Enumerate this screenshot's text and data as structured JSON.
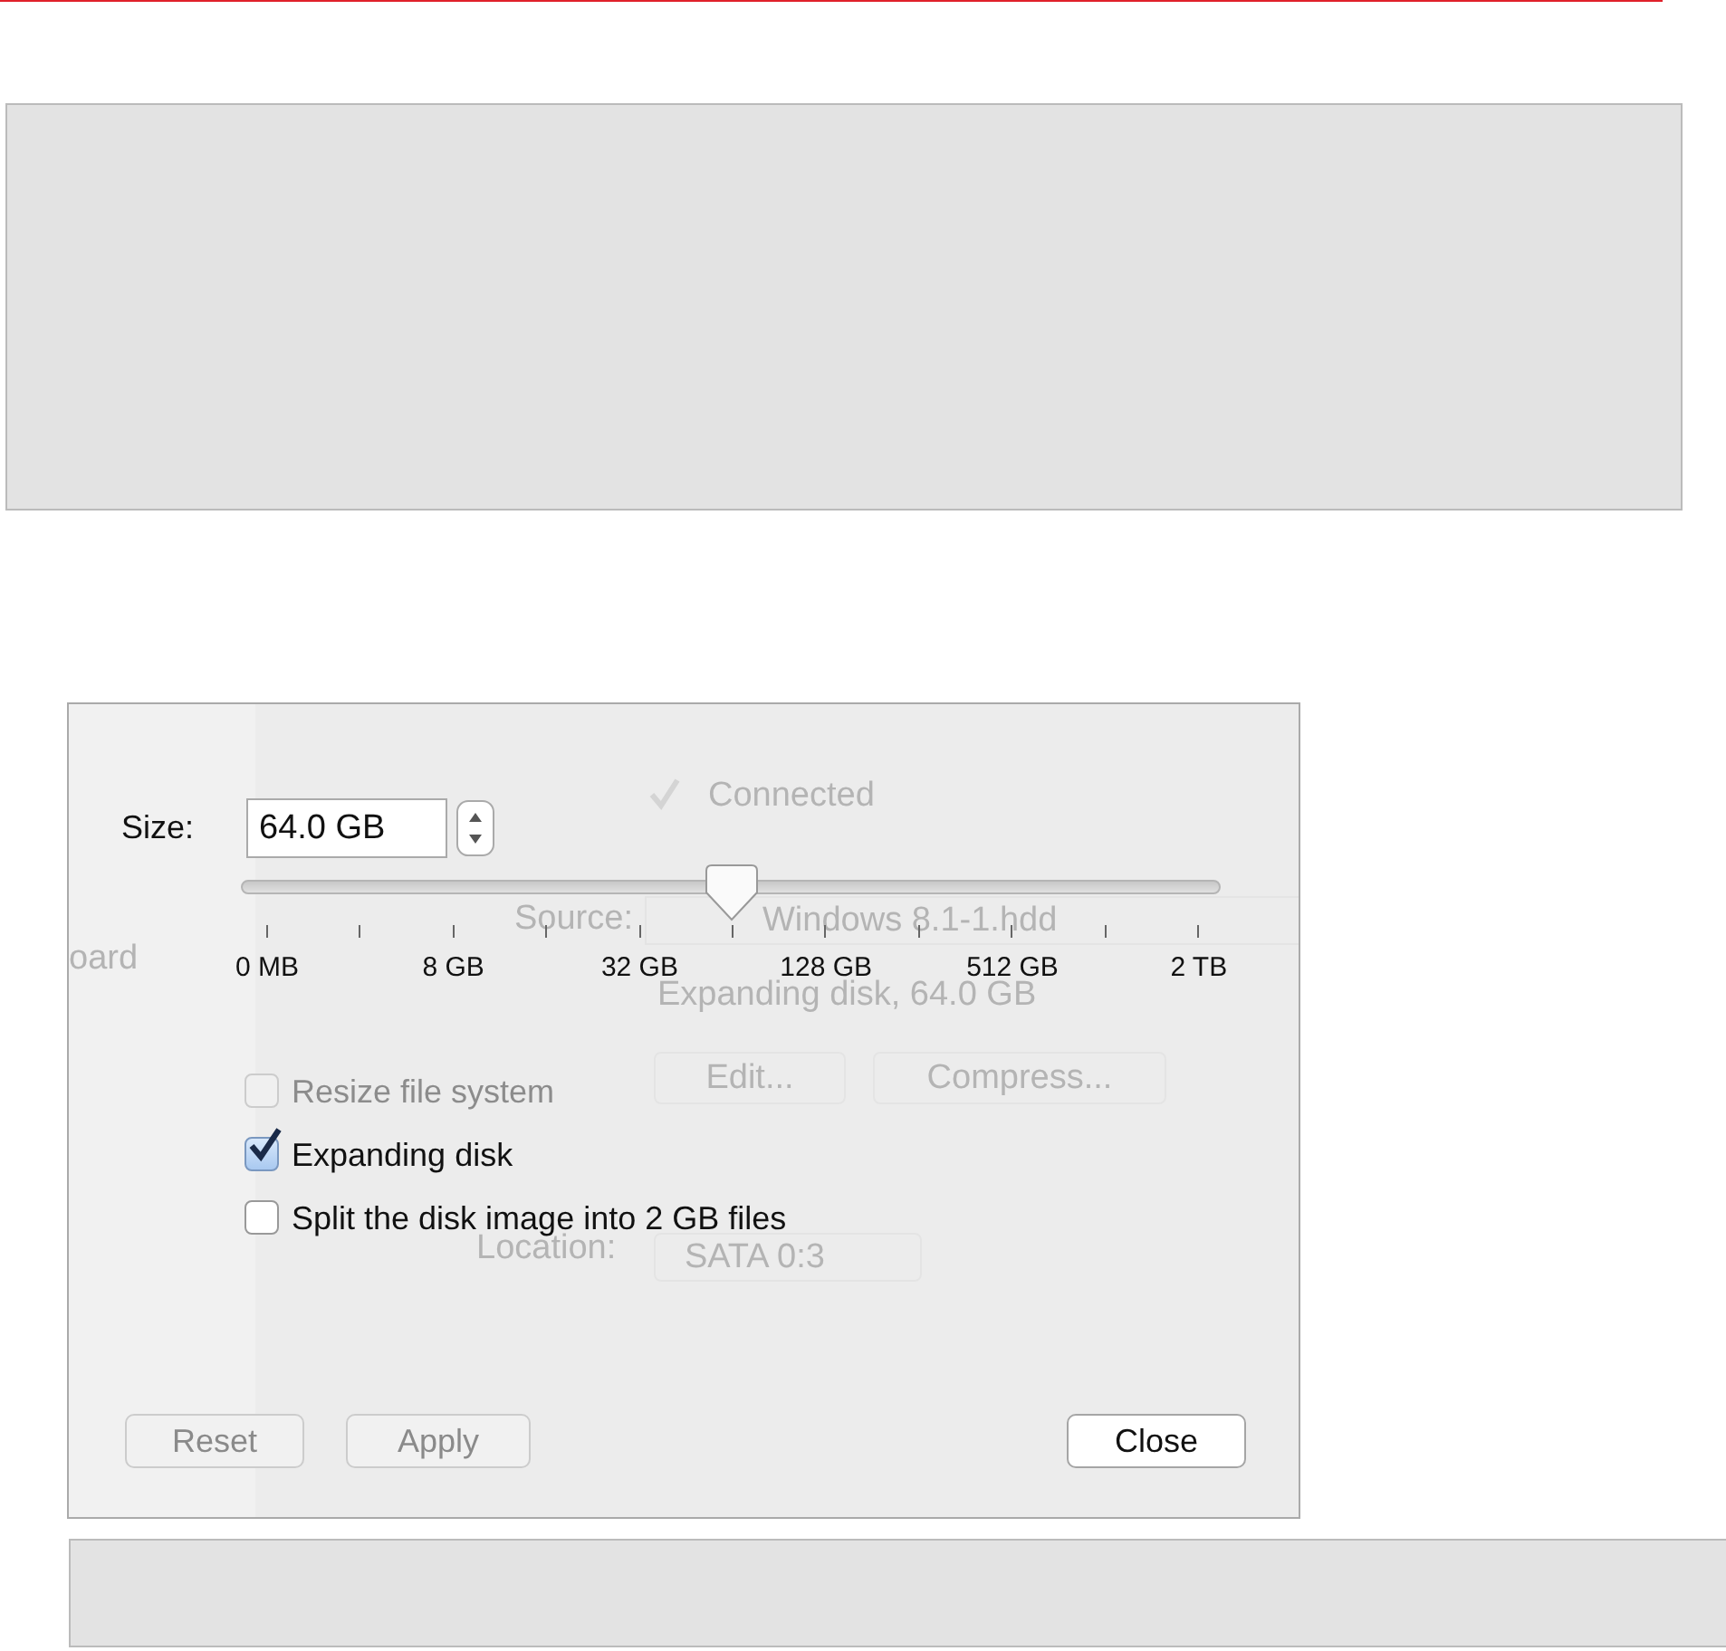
{
  "background_window": {
    "sidebar_item": "oard",
    "connected": {
      "label": "Connected",
      "checked": true
    },
    "source_label": "Source:",
    "source_value": "Windows 8.1-1.hdd",
    "disk_info": "Expanding disk, 64.0 GB",
    "buttons": [
      "Edit...",
      "Compress..."
    ],
    "location_label": "Location:",
    "location_value": "SATA 0:3"
  },
  "dialog": {
    "size": {
      "label": "Size:",
      "value": "64.0 GB"
    },
    "slider": {
      "level": 0.5,
      "labels": [
        "0 MB",
        "8 GB",
        "32 GB",
        "128 GB",
        "512 GB",
        "2 TB"
      ]
    },
    "options": [
      {
        "label": "Resize file system",
        "checked": false,
        "disabled": true
      },
      {
        "label": "Expanding disk",
        "checked": true,
        "disabled": false
      },
      {
        "label": "Split the disk image into 2 GB files",
        "checked": false,
        "disabled": false
      }
    ],
    "buttons": [
      {
        "label": "Reset",
        "disabled": true
      },
      {
        "label": "Apply",
        "disabled": true
      },
      {
        "label": "Close",
        "disabled": false
      }
    ]
  }
}
